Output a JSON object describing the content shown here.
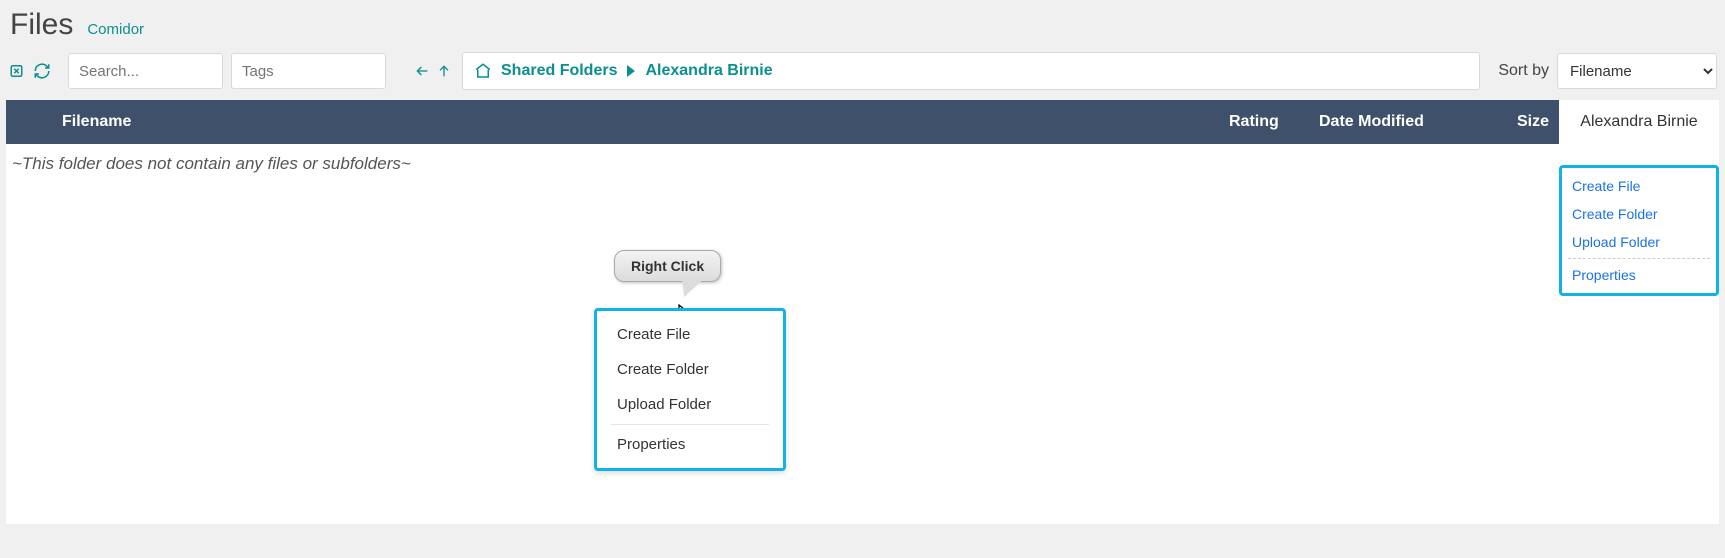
{
  "header": {
    "title": "Files",
    "subtitle": "Comidor"
  },
  "toolbar": {
    "search_placeholder": "Search...",
    "tags_placeholder": "Tags",
    "sort_label": "Sort by",
    "sort_value": "Filename"
  },
  "breadcrumb": {
    "root": "Shared Folders",
    "current": "Alexandra Birnie"
  },
  "columns": {
    "filename": "Filename",
    "rating": "Rating",
    "date": "Date Modified",
    "size": "Size",
    "user": "Alexandra Birnie"
  },
  "empty_message": "~This folder does not contain any files or subfolders~",
  "tooltip": "Right Click",
  "context_menu": {
    "create_file": "Create File",
    "create_folder": "Create Folder",
    "upload_folder": "Upload Folder",
    "properties": "Properties"
  },
  "side_panel": {
    "create_file": "Create File",
    "create_folder": "Create Folder",
    "upload_folder": "Upload Folder",
    "properties": "Properties"
  }
}
